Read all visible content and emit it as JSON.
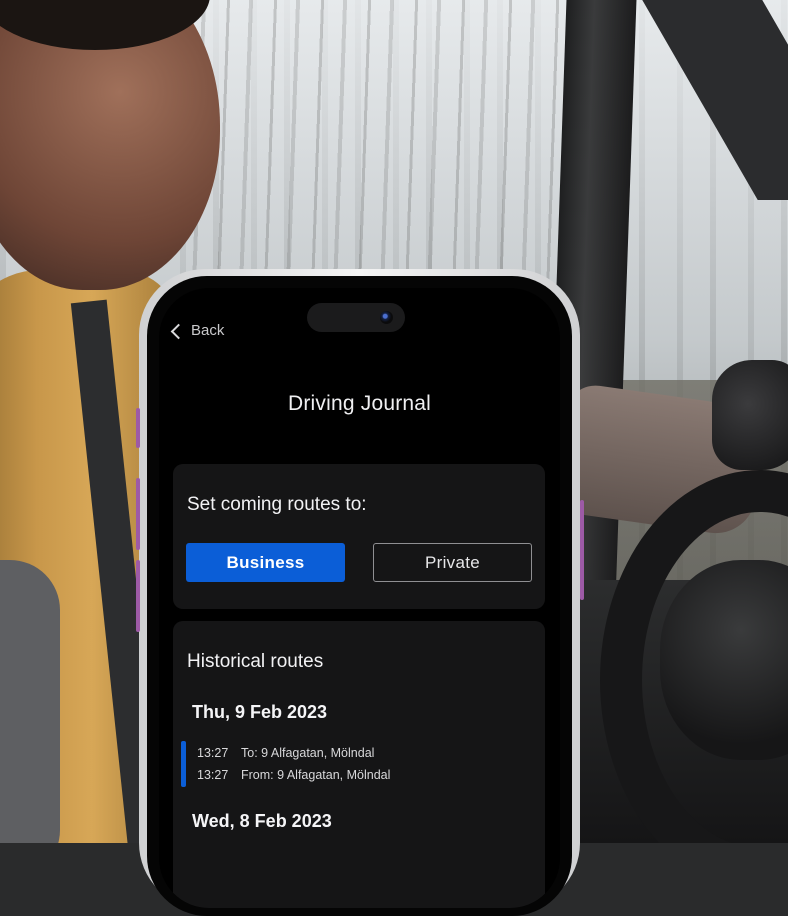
{
  "nav": {
    "back_label": "Back"
  },
  "app": {
    "title": "Driving Journal"
  },
  "route_setting": {
    "heading": "Set coming routes to:",
    "options": [
      {
        "label": "Business",
        "selected": true
      },
      {
        "label": "Private",
        "selected": false
      }
    ]
  },
  "history": {
    "heading": "Historical routes",
    "days": [
      {
        "date": "Thu, 9 Feb 2023",
        "trips": [
          {
            "time": "13:27",
            "text": "To: 9 Alfagatan, Mölndal"
          },
          {
            "time": "13:27",
            "text": "From: 9 Alfagatan, Mölndal"
          }
        ]
      },
      {
        "date": "Wed, 8 Feb 2023"
      }
    ]
  },
  "colors": {
    "accent": "#0b5ed7",
    "screen_bg": "#000000",
    "card_bg": "#151516"
  },
  "icons": [
    "chevron-left-icon",
    "camera-icon"
  ]
}
